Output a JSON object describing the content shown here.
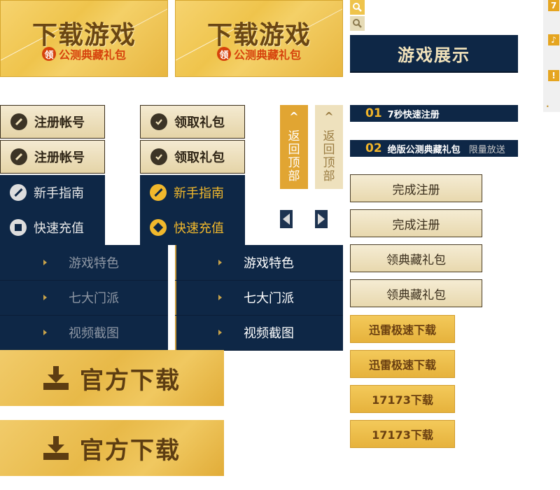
{
  "promo": {
    "title": "下载游戏",
    "badge": "领",
    "subtitle": "公测典藏礼包"
  },
  "showcase": {
    "label": "游戏展示"
  },
  "side_icons": [
    "7",
    "♪",
    "!",
    "."
  ],
  "register": {
    "label": "注册帐号"
  },
  "gift": {
    "label": "领取礼包"
  },
  "guide": {
    "label": "新手指南"
  },
  "recharge": {
    "label": "快速充值"
  },
  "back_to_top": {
    "arrow": "^",
    "label": "返回顶部"
  },
  "steps": [
    {
      "num": "01",
      "text": "7秒快速注册",
      "note": ""
    },
    {
      "num": "02",
      "text": "绝版公测典藏礼包",
      "note": "限量放送"
    }
  ],
  "complete_register": {
    "label": "完成注册"
  },
  "claim_pack": {
    "label": "领典藏礼包"
  },
  "thunder": {
    "label": "迅雷极速下载"
  },
  "seventeen": {
    "label": "17173下载"
  },
  "menu_items": [
    "游戏特色",
    "七大门派",
    "视频截图"
  ],
  "official_download": {
    "label": "官方下载"
  },
  "colors": {
    "navy": "#0e2746",
    "gold": "#efc44c",
    "orange_red": "#d6420c",
    "accent_gold": "#f1b82c"
  }
}
